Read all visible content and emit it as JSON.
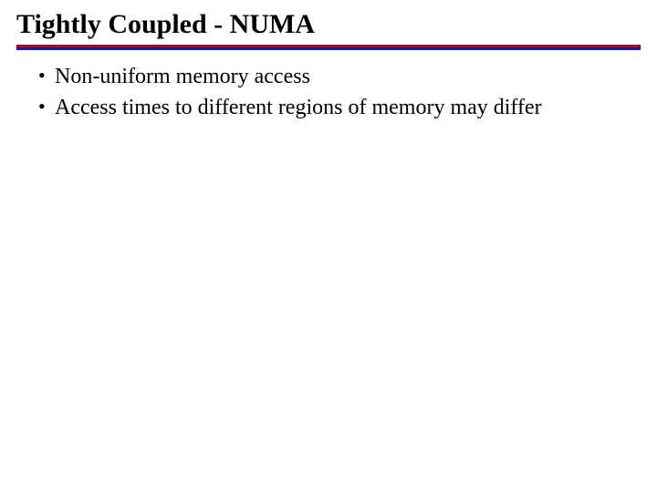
{
  "slide": {
    "title": "Tightly Coupled - NUMA",
    "bullets": [
      "Non-uniform memory access",
      "Access times to different regions of memory may differ"
    ],
    "rule_colors": {
      "top": "#cc0000",
      "bottom": "#1a1a9a"
    }
  }
}
